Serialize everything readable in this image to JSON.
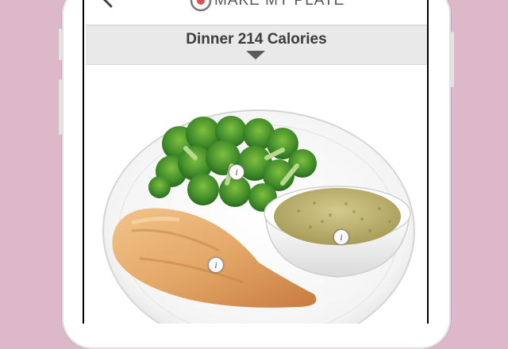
{
  "app": {
    "brand_name": "MAKE MY PLATE"
  },
  "nav": {
    "back_icon": "chevron-left-icon",
    "logo_icon": "plate-logo-icon"
  },
  "meal": {
    "title": "Dinner 214 Calories",
    "toggle_icon": "caret-down-icon"
  },
  "plate": {
    "foods": [
      {
        "name": "broccoli",
        "info_icon": "info-icon",
        "info_glyph": "i"
      },
      {
        "name": "quinoa",
        "info_icon": "info-icon",
        "info_glyph": "i"
      },
      {
        "name": "chicken-breast",
        "info_icon": "info-icon",
        "info_glyph": "i"
      }
    ]
  },
  "colors": {
    "background": "#dcb8c8",
    "header_bar": "#e9e9e9",
    "logo_accent": "#d9534f",
    "broccoli": "#3f8a2a",
    "quinoa": "#b9ae6e",
    "chicken": "#e3a868"
  }
}
